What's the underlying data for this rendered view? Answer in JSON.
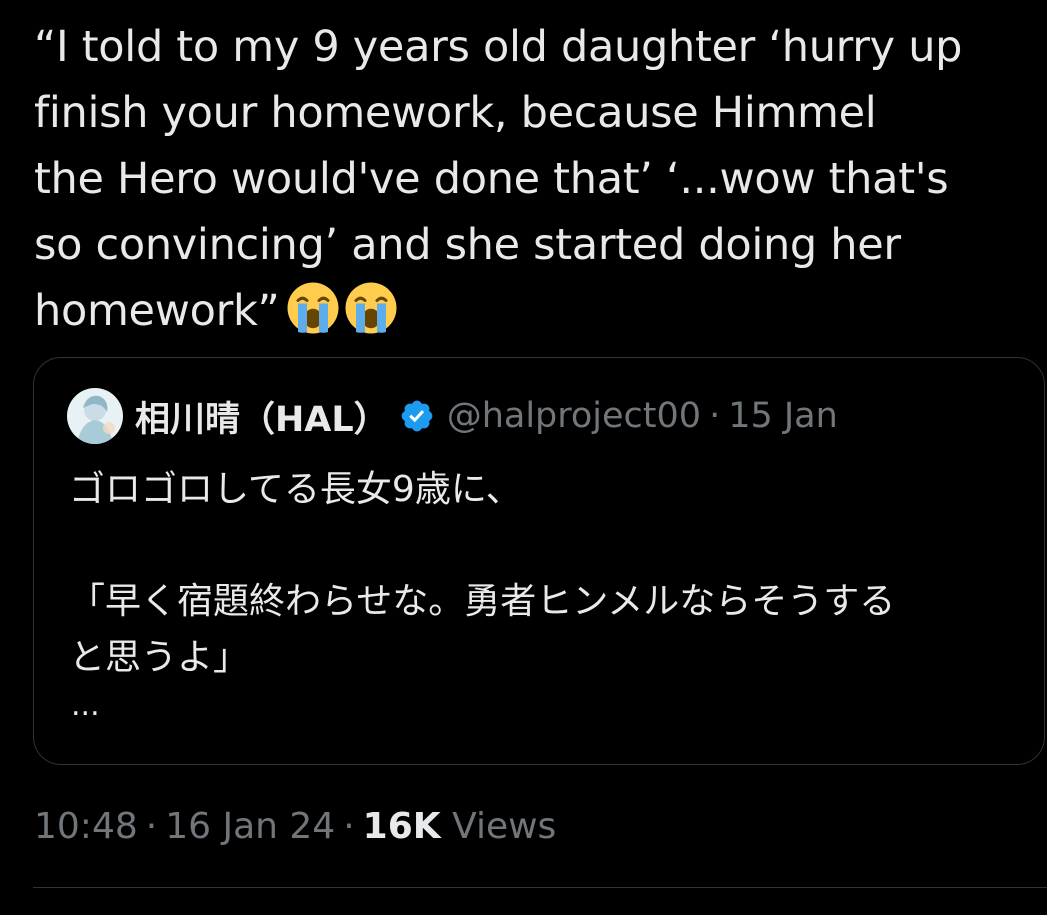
{
  "tweet": {
    "text_lines": [
      "“I told to my 9 years old daughter ‘hurry up",
      "finish your homework, because Himmel",
      "the Hero would've done that’ ‘...wow that's",
      "so convincing’ and she started doing her",
      "homework”"
    ],
    "emojis": [
      "loudly-crying-face-icon",
      "loudly-crying-face-icon"
    ]
  },
  "quote": {
    "name": "相川晴（HAL）",
    "handle": "@halproject00",
    "separator": "·",
    "date": "15 Jan",
    "body_lines": [
      "ゴロゴロしてる長女9歳に、",
      "",
      "「早く宿題終わらせな。勇者ヒンメルならそうする",
      "と思うよ」"
    ],
    "ellipsis": "..."
  },
  "meta": {
    "time": "10:48",
    "separator": "·",
    "date": "16 Jan 24",
    "views_count": "16K",
    "views_label": "Views"
  },
  "colors": {
    "background": "#000000",
    "text": "#e7e9ea",
    "secondary": "#71767b",
    "border": "#2f3336",
    "verified": "#1d9bf0"
  }
}
